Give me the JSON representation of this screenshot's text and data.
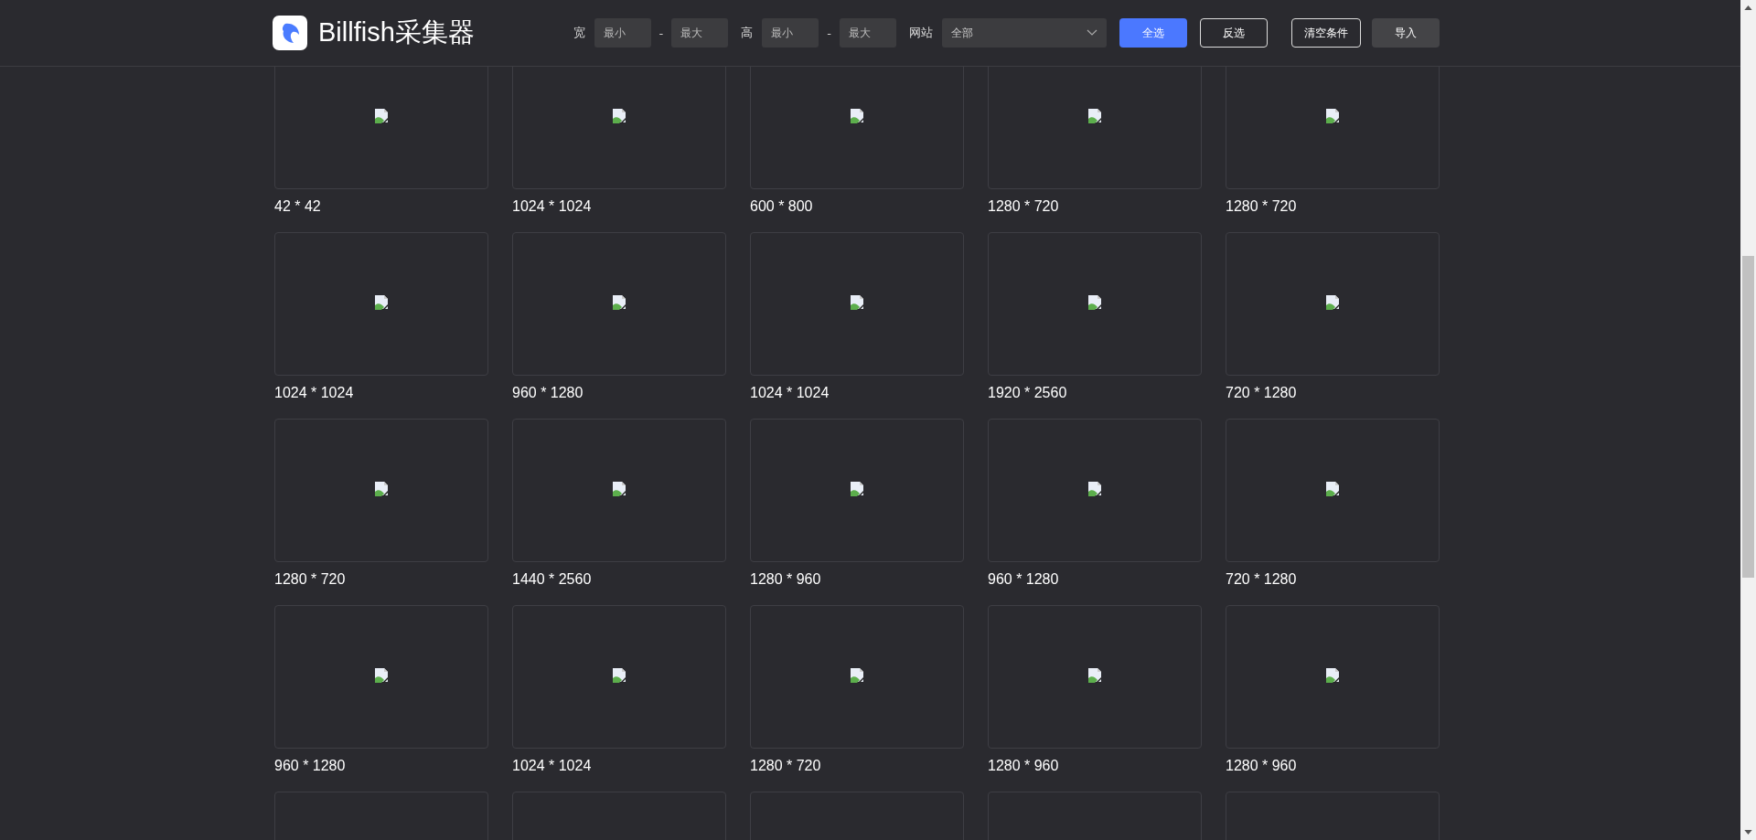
{
  "header": {
    "app_name": "Billfish采集器",
    "width_label": "宽",
    "height_label": "高",
    "range_dash": "-",
    "site_label": "网站",
    "width_min": {
      "placeholder": "最小"
    },
    "width_max": {
      "placeholder": "最大"
    },
    "height_min": {
      "placeholder": "最小"
    },
    "height_max": {
      "placeholder": "最大"
    },
    "site_select": {
      "value": "全部"
    },
    "buttons": [
      {
        "label": "全选",
        "kind": "primary"
      },
      {
        "label": "反选",
        "kind": "outline"
      },
      {
        "label": "清空条件",
        "kind": "outline"
      },
      {
        "label": "导入",
        "kind": "plain"
      }
    ]
  },
  "images": [
    {
      "kind": "image",
      "size": "42 * 42"
    },
    {
      "kind": "image",
      "size": "1024 * 1024"
    },
    {
      "kind": "image",
      "size": "600 * 800"
    },
    {
      "kind": "image",
      "size": "1280 * 720"
    },
    {
      "kind": "image",
      "size": "1280 * 720"
    },
    {
      "kind": "image",
      "size": "1024 * 1024"
    },
    {
      "kind": "image",
      "size": "960 * 1280"
    },
    {
      "kind": "image",
      "size": "1024 * 1024"
    },
    {
      "kind": "image",
      "size": "1920 * 2560"
    },
    {
      "kind": "image",
      "size": "720 * 1280"
    },
    {
      "kind": "image",
      "size": "1280 * 720"
    },
    {
      "kind": "image",
      "size": "1440 * 2560"
    },
    {
      "kind": "image",
      "size": "1280 * 960"
    },
    {
      "kind": "image",
      "size": "960 * 1280"
    },
    {
      "kind": "image",
      "size": "720 * 1280"
    },
    {
      "kind": "image",
      "size": "960 * 1280"
    },
    {
      "kind": "image",
      "size": "1024 * 1024"
    },
    {
      "kind": "image",
      "size": "1280 * 720"
    },
    {
      "kind": "image",
      "size": "1280 * 960"
    },
    {
      "kind": "image",
      "size": "1280 * 960"
    },
    {
      "kind": "image"
    },
    {
      "kind": "image"
    },
    {
      "kind": "image"
    },
    {
      "kind": "image"
    },
    {
      "kind": "image"
    }
  ]
}
